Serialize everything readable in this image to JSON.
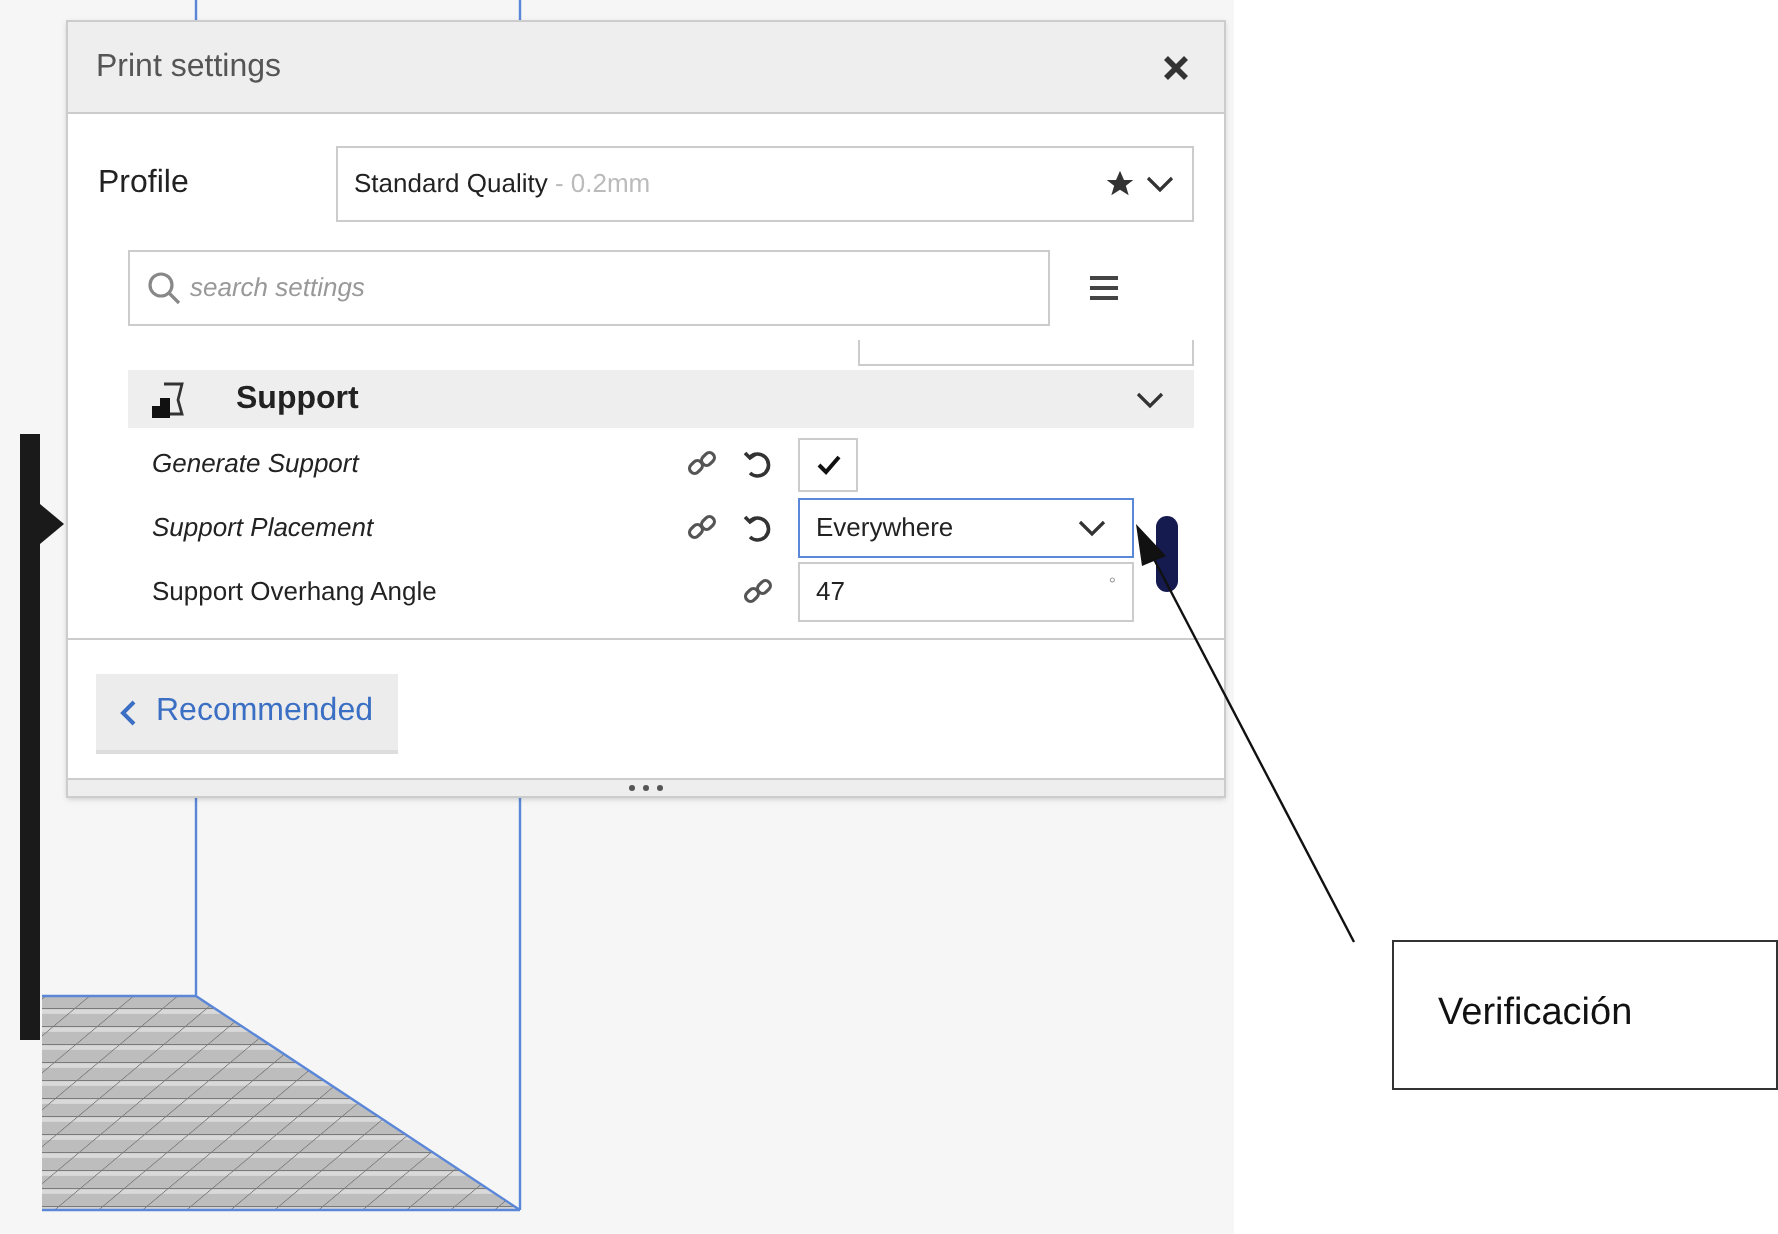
{
  "window": {
    "title": "Print settings"
  },
  "profile": {
    "label": "Profile",
    "value": "Standard Quality",
    "detail": "- 0.2mm"
  },
  "search": {
    "placeholder": "search settings"
  },
  "category": {
    "title": "Support",
    "expanded": true
  },
  "settings": [
    {
      "kind": "checkbox",
      "label": "Generate Support",
      "modified": true,
      "checked": true
    },
    {
      "kind": "dropdown",
      "label": "Support Placement",
      "modified": true,
      "value": "Everywhere",
      "focused": true
    },
    {
      "kind": "number",
      "label": "Support Overhang Angle",
      "modified": false,
      "value": "47",
      "unit": "°"
    }
  ],
  "footer": {
    "button": "Recommended"
  },
  "annotation": {
    "text": "Verificación"
  }
}
